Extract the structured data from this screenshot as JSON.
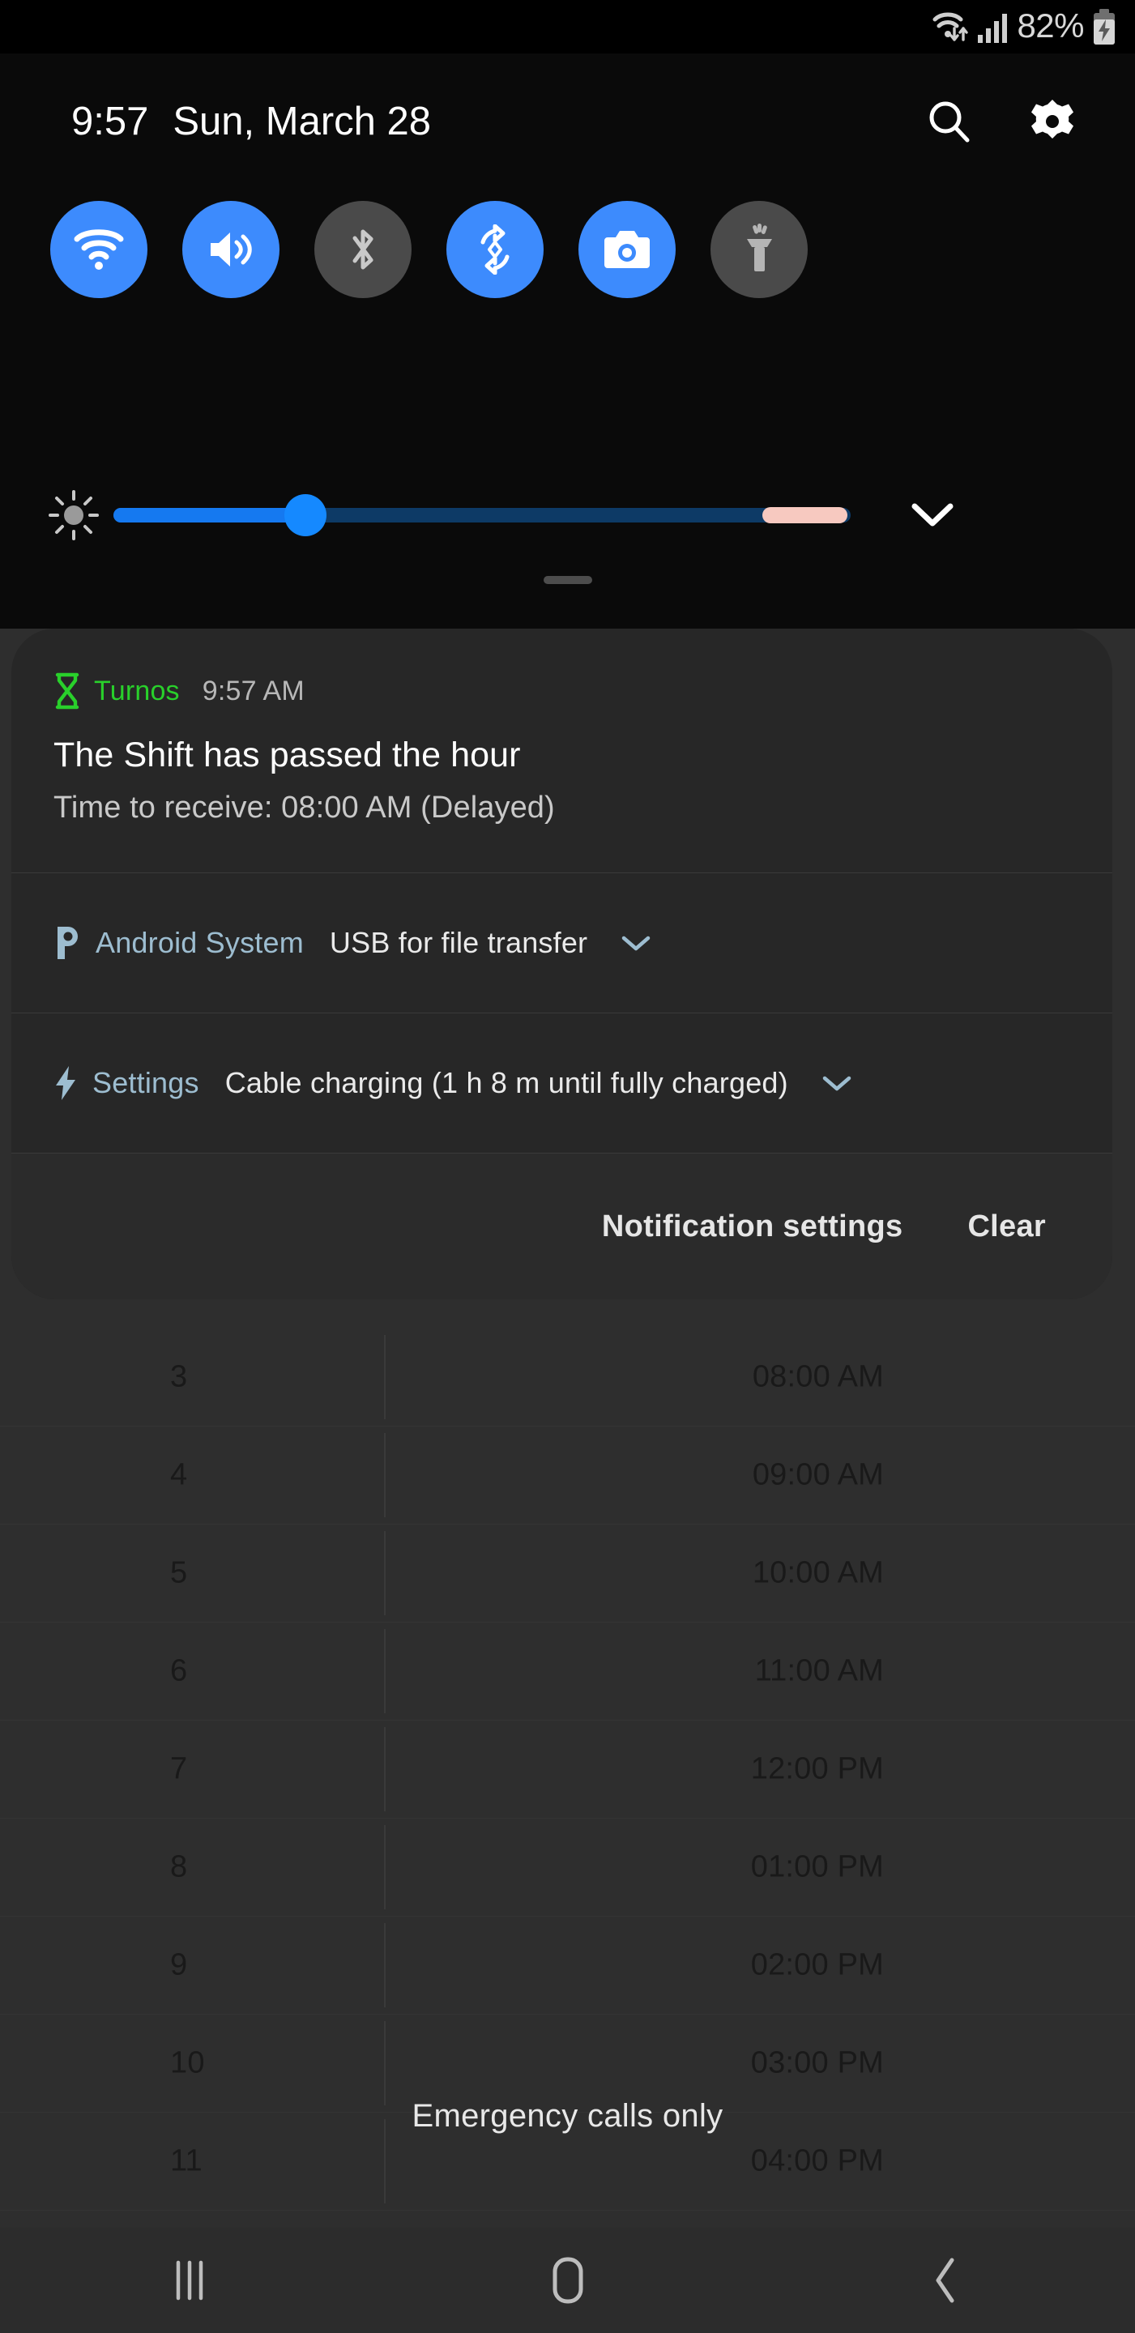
{
  "status_bar": {
    "battery_percent": "82%",
    "icons": [
      "wifi-data-icon",
      "signal-bars-icon",
      "battery-charging-icon"
    ]
  },
  "quick_settings": {
    "clock": "9:57",
    "date": "Sun, March 28",
    "search_icon": "search-icon",
    "settings_icon": "gear-icon",
    "toggles": [
      {
        "name": "wifi",
        "icon": "wifi-icon",
        "state": "on"
      },
      {
        "name": "sound",
        "icon": "volume-icon",
        "state": "on"
      },
      {
        "name": "bluetooth",
        "icon": "bluetooth-icon",
        "state": "off"
      },
      {
        "name": "auto-rotate",
        "icon": "auto-rotate-icon",
        "state": "on"
      },
      {
        "name": "scan",
        "icon": "camera-icon",
        "state": "on"
      },
      {
        "name": "flashlight",
        "icon": "flashlight-icon",
        "state": "off"
      }
    ],
    "brightness": {
      "icon": "brightness-icon",
      "value_percent": 26,
      "auto_segment_start_percent": 88,
      "auto_segment_end_percent": 98,
      "expand_icon": "chevron-down-icon"
    }
  },
  "notifications": [
    {
      "id": "turnos",
      "app": "Turnos",
      "icon": "hourglass-icon",
      "icon_color": "#29d02b",
      "time": "9:57 AM",
      "title": "The Shift has passed the hour",
      "body": "Time to receive: 08:00 AM (Delayed)"
    },
    {
      "id": "android-system",
      "app": "Android System",
      "icon": "usb-transfer-icon",
      "icon_color": "#9dbdd0",
      "text": "USB for file transfer",
      "expand_icon": "chevron-down-icon"
    },
    {
      "id": "settings-charging",
      "app": "Settings",
      "icon": "lightning-bolt-icon",
      "icon_color": "#9dbdd0",
      "text": "Cable charging (1 h 8 m until fully charged)",
      "expand_icon": "chevron-down-icon"
    }
  ],
  "shade_footer": {
    "notification_settings_label": "Notification settings",
    "clear_label": "Clear"
  },
  "background_app": {
    "emergency_text": "Emergency calls only",
    "rows": [
      {
        "num": "3",
        "time": "08:00 AM"
      },
      {
        "num": "4",
        "time": "09:00 AM"
      },
      {
        "num": "5",
        "time": "10:00 AM"
      },
      {
        "num": "6",
        "time": "11:00 AM"
      },
      {
        "num": "7",
        "time": "12:00 PM"
      },
      {
        "num": "8",
        "time": "01:00 PM"
      },
      {
        "num": "9",
        "time": "02:00 PM"
      },
      {
        "num": "10",
        "time": "03:00 PM"
      },
      {
        "num": "11",
        "time": "04:00 PM"
      }
    ]
  },
  "nav_bar": {
    "recents_icon": "recents-icon",
    "home_icon": "home-icon",
    "back_icon": "back-icon"
  }
}
